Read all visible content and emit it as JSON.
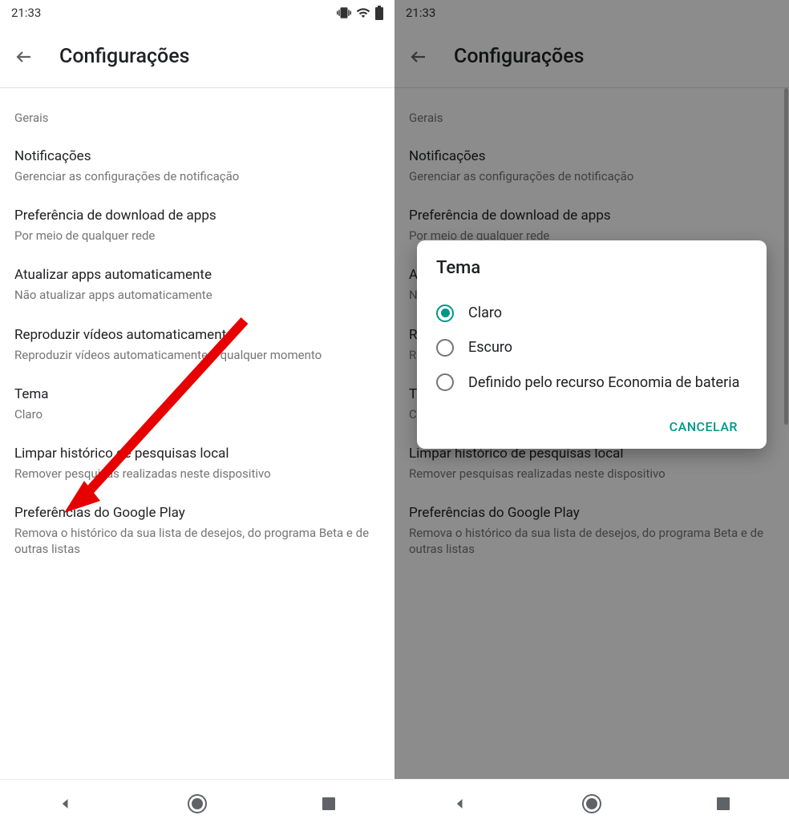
{
  "status": {
    "time": "21:33"
  },
  "header": {
    "title": "Configurações"
  },
  "section": {
    "general": "Gerais"
  },
  "settings": {
    "notifications": {
      "title": "Notificações",
      "subtitle": "Gerenciar as configurações de notificação"
    },
    "download_pref": {
      "title": "Preferência de download de apps",
      "subtitle": "Por meio de qualquer rede"
    },
    "auto_update": {
      "title": "Atualizar apps automaticamente",
      "subtitle": "Não atualizar apps automaticamente"
    },
    "auto_video": {
      "title": "Reproduzir vídeos automaticamente",
      "subtitle": "Reproduzir vídeos automaticamente a qualquer momento"
    },
    "theme": {
      "title": "Tema",
      "subtitle": "Claro"
    },
    "clear_search": {
      "title": "Limpar histórico de pesquisas local",
      "subtitle": "Remover pesquisas realizadas neste dispositivo"
    },
    "play_prefs": {
      "title": "Preferências do Google Play",
      "subtitle": "Remova o histórico da sua lista de desejos, do programa Beta e de outras listas"
    }
  },
  "dialog": {
    "title": "Tema",
    "options": {
      "light": "Claro",
      "dark": "Escuro",
      "battery": "Definido pelo recurso Economia de bateria"
    },
    "cancel": "CANCELAR"
  }
}
